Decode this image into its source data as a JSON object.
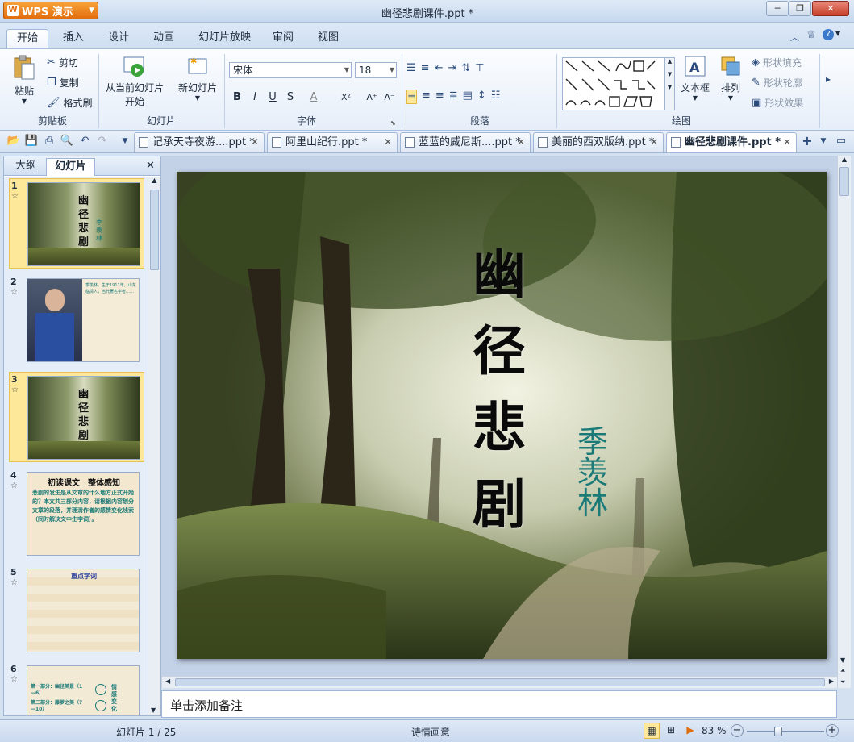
{
  "app": {
    "logo": "WPS 演示",
    "window_title": "幽径悲剧课件.ppt *"
  },
  "ribbon_tabs": [
    "开始",
    "插入",
    "设计",
    "动画",
    "幻灯片放映",
    "审阅",
    "视图"
  ],
  "clipboard": {
    "paste": "粘贴",
    "cut": "剪切",
    "copy": "复制",
    "format_painter": "格式刷",
    "group": "剪贴板"
  },
  "slides_group": {
    "from_current_line1": "从当前幻灯片",
    "from_current_line2": "开始",
    "new_slide": "新幻灯片",
    "group": "幻灯片"
  },
  "font": {
    "name": "宋体",
    "size": "18",
    "bold": "B",
    "italic": "I",
    "underline": "U",
    "strike": "S",
    "color": "A",
    "superscript": "X²",
    "grow": "A⁺",
    "shrink": "A⁻",
    "group": "字体"
  },
  "paragraph": {
    "group": "段落"
  },
  "drawing": {
    "textbox": "文本框",
    "arrange": "排列",
    "shape_fill": "形状填充",
    "shape_outline": "形状轮廓",
    "shape_effect": "形状效果",
    "group": "绘图"
  },
  "doc_tabs": [
    "记承天寺夜游....ppt *",
    "阿里山纪行.ppt *",
    "蓝蓝的威尼斯....ppt *",
    "美丽的西双版纳.ppt *",
    "幽径悲剧课件.ppt *"
  ],
  "left_panel": {
    "tab_outline": "大纲",
    "tab_slides": "幻灯片"
  },
  "thumbnails": [
    {
      "num": "1",
      "title": "幽径悲剧",
      "author": "季羡林"
    },
    {
      "num": "2",
      "text": "季羡林，生于1911年，山东临清人，当代著名学者……"
    },
    {
      "num": "3",
      "title": "幽径悲剧"
    },
    {
      "num": "4",
      "title": "初读课文　整体感知",
      "body": "悲剧的发生是从文章的什么地方正式开始的？本文共三部分内容，请根据内容划分文章的段落，并理清作者的感情变化线索（同时解决文中生字词）。"
    },
    {
      "num": "5",
      "title": "重点字词"
    },
    {
      "num": "6",
      "row1": "第一部分：幽径美景（1—6）",
      "row2": "第二部分：藤萝之美（7—10）",
      "side": "情感变化"
    }
  ],
  "slide": {
    "title_chars": [
      "幽",
      "径",
      "悲",
      "剧"
    ],
    "author_chars": [
      "季",
      "羡",
      "林"
    ]
  },
  "notes_placeholder": "单击添加备注",
  "status": {
    "slide_counter": "幻灯片 1 / 25",
    "theme": "诗情画意",
    "zoom": "83 %"
  },
  "zoom_value_percent": 83,
  "colors": {
    "accent": "#e26d0d",
    "ribbon_bg": "#e6eef9",
    "author_teal": "#1b7a78",
    "selection": "#fde89a"
  }
}
